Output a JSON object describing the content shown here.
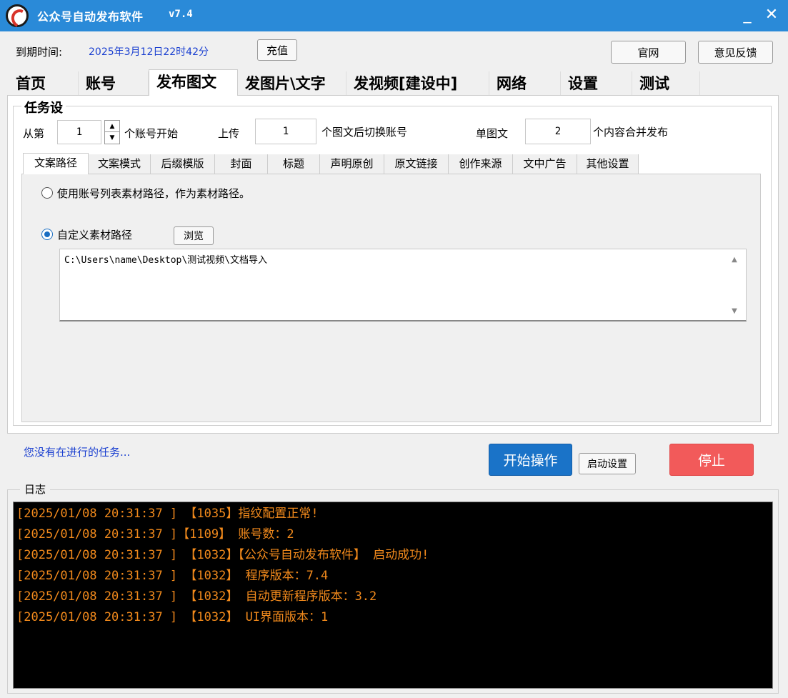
{
  "titlebar": {
    "title": "公众号自动发布软件",
    "version": "v7.4",
    "minimize": "_",
    "close": "✕"
  },
  "header": {
    "expire_label": "到期时间:",
    "expire_value": "2025年3月12日22时42分",
    "recharge": "充值",
    "official_site": "官网",
    "feedback": "意见反馈"
  },
  "main_tabs": [
    "首页",
    "账号",
    "发布图文",
    "发图片\\文字",
    "发视频[建设中]",
    "网络",
    "设置",
    "测试"
  ],
  "task": {
    "group_title": "任务设",
    "from_label": "从第",
    "from_value": "1",
    "from_suffix": "个账号开始",
    "upload_label": "上传",
    "upload_value": "1",
    "upload_suffix": "个图文后切换账号",
    "single_label": "单图文",
    "single_value": "2",
    "single_suffix": "个内容合并发布"
  },
  "sub_tabs": [
    "文案路径",
    "文案模式",
    "后缀模版",
    "封面",
    "标题",
    "声明原创",
    "原文链接",
    "创作来源",
    "文中广告",
    "其他设置"
  ],
  "path_tab": {
    "option1": "使用账号列表素材路径，作为素材路径。",
    "option2": "自定义素材路径",
    "browse": "浏览",
    "path_value": "C:\\Users\\name\\Desktop\\测试视频\\文档导入"
  },
  "status": {
    "message": "您没有在进行的任务...",
    "start": "开始操作",
    "startup_settings": "启动设置",
    "stop": "停止"
  },
  "colors": {
    "titlebar": "#2a8ad8",
    "start_button": "#1a73c8",
    "stop_button": "#f25a5a",
    "status_text": "#1a3fd0",
    "log_text": "#f28a1c"
  },
  "log": {
    "title": "日志",
    "lines": [
      "[2025/01/08 20:31:37 ] 【1035】指纹配置正常!",
      "[2025/01/08 20:31:37 ]【1109】 账号数：2",
      "[2025/01/08 20:31:37 ] 【1032】【公众号自动发布软件】 启动成功!",
      "[2025/01/08 20:31:37 ] 【1032】 程序版本：7.4",
      "[2025/01/08 20:31:37 ] 【1032】 自动更新程序版本：3.2",
      "[2025/01/08 20:31:37 ] 【1032】 UI界面版本：1"
    ]
  }
}
